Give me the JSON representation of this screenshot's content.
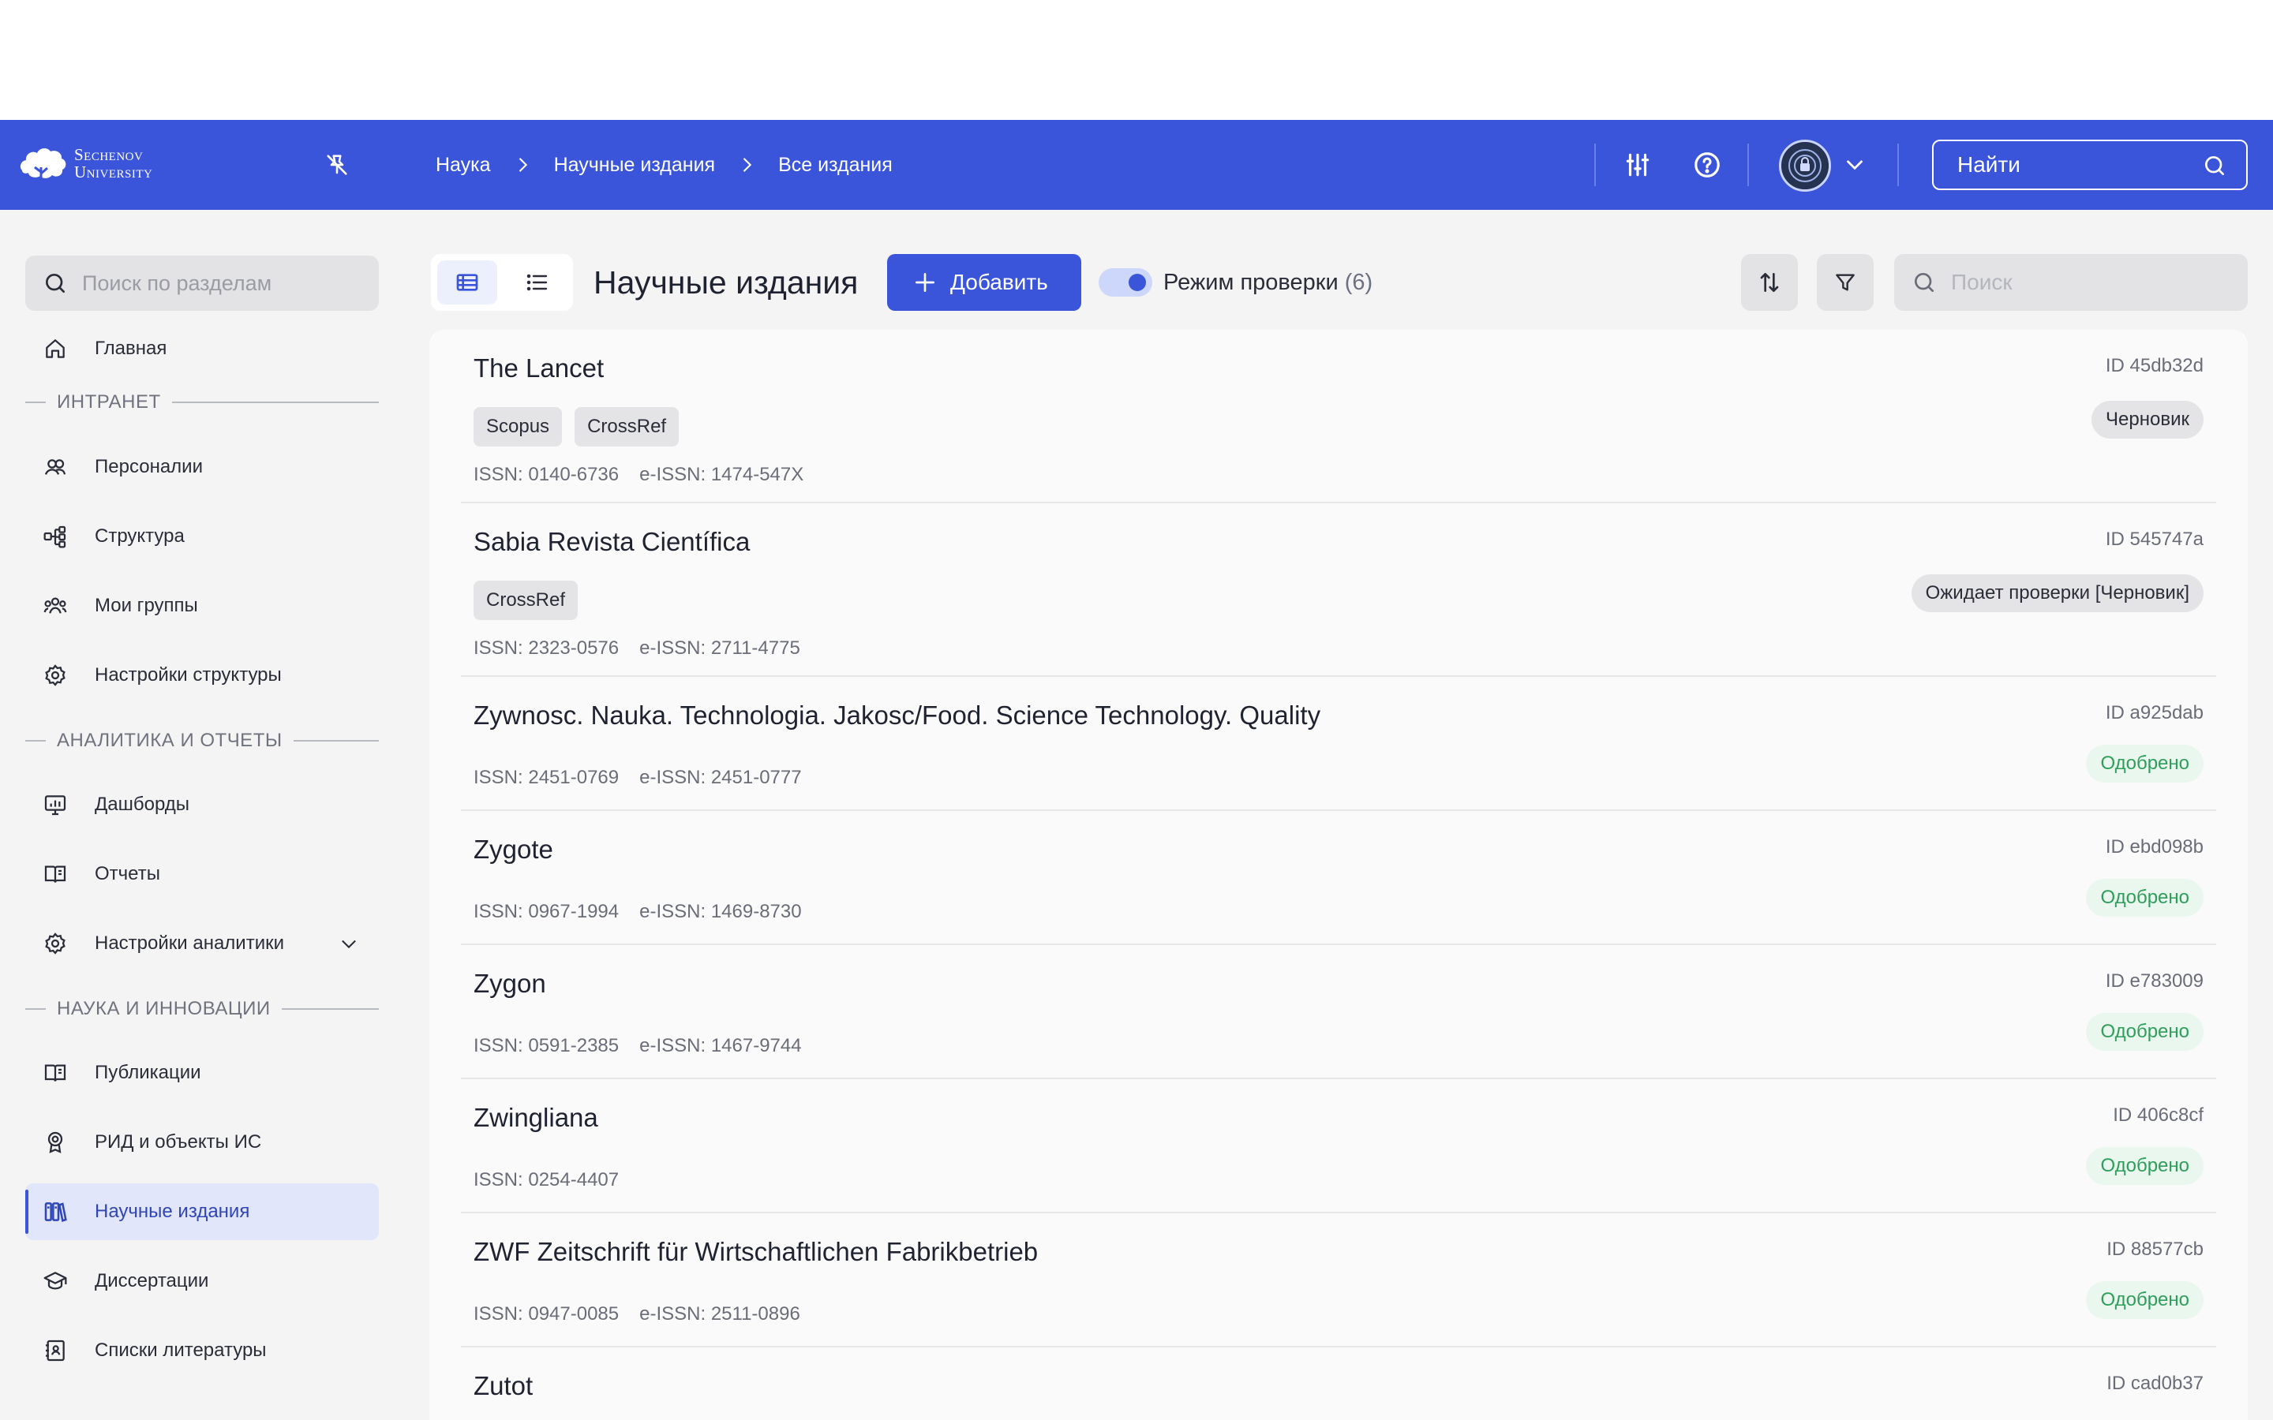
{
  "header": {
    "logo_line1": "Sechenov",
    "logo_line2": "University",
    "breadcrumb": [
      "Наука",
      "Научные издания",
      "Все издания"
    ],
    "search_label": "Найти",
    "accent": "#3a55d9"
  },
  "sidebar": {
    "search_placeholder": "Поиск по разделам",
    "home": "Главная",
    "sections": {
      "intranet": "ИНТРАНЕТ",
      "analytics": "АНАЛИТИКА И ОТЧЕТЫ",
      "science": "НАУКА И ИННОВАЦИИ"
    },
    "items": {
      "persons": "Персоналии",
      "structure": "Структура",
      "groups": "Мои группы",
      "structure_settings": "Настройки структуры",
      "dashboards": "Дашборды",
      "reports": "Отчеты",
      "analytics_settings": "Настройки аналитики",
      "publications": "Публикации",
      "rid": "РИД и объекты ИС",
      "journals": "Научные издания",
      "dissertations": "Диссертации",
      "bibliography": "Списки литературы"
    }
  },
  "main": {
    "title": "Научные издания",
    "add_label": "Добавить",
    "review_mode_label": "Режим проверки",
    "review_mode_count": "(6)",
    "review_mode_on": true,
    "search_placeholder": "Поиск",
    "rows": [
      {
        "title": "The Lancet",
        "tags": [
          "Scopus",
          "CrossRef"
        ],
        "issn": "ISSN: 0140-6736",
        "eissn": "e-ISSN: 1474-547X",
        "id": "ID 45db32d",
        "status": "Черновик",
        "status_color": "gray"
      },
      {
        "title": "Sabia Revista Científica",
        "tags": [
          "CrossRef"
        ],
        "issn": "ISSN: 2323-0576",
        "eissn": "e-ISSN: 2711-4775",
        "id": "ID 545747a",
        "status": "Ожидает проверки [Черновик]",
        "status_color": "gray"
      },
      {
        "title": "Zywnosc. Nauka. Technologia. Jakosc/Food. Science Technology. Quality",
        "tags": [],
        "issn": "ISSN: 2451-0769",
        "eissn": "e-ISSN: 2451-0777",
        "id": "ID a925dab",
        "status": "Одобрено",
        "status_color": "green"
      },
      {
        "title": "Zygote",
        "tags": [],
        "issn": "ISSN: 0967-1994",
        "eissn": "e-ISSN: 1469-8730",
        "id": "ID ebd098b",
        "status": "Одобрено",
        "status_color": "green"
      },
      {
        "title": "Zygon",
        "tags": [],
        "issn": "ISSN: 0591-2385",
        "eissn": "e-ISSN: 1467-9744",
        "id": "ID e783009",
        "status": "Одобрено",
        "status_color": "green"
      },
      {
        "title": "Zwingliana",
        "tags": [],
        "issn": "ISSN: 0254-4407",
        "eissn": "",
        "id": "ID 406c8cf",
        "status": "Одобрено",
        "status_color": "green"
      },
      {
        "title": "ZWF Zeitschrift für Wirtschaftlichen Fabrikbetrieb",
        "tags": [],
        "issn": "ISSN: 0947-0085",
        "eissn": "e-ISSN: 2511-0896",
        "id": "ID 88577cb",
        "status": "Одобрено",
        "status_color": "green"
      },
      {
        "title": "Zutot",
        "tags": [],
        "issn": "",
        "eissn": "",
        "id": "ID cad0b37",
        "status": "",
        "status_color": "green"
      }
    ]
  }
}
